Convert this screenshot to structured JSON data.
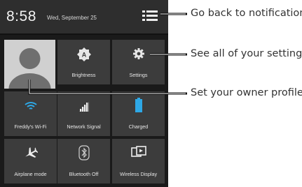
{
  "status_bar": {
    "time": "8:58",
    "date": "Wed, September 25",
    "notifications_icon": "notifications-list-icon"
  },
  "tiles": {
    "brightness": {
      "label": "Brightness",
      "icon": "brightness-auto-icon"
    },
    "settings": {
      "label": "Settings",
      "icon": "gear-icon"
    },
    "wifi": {
      "label": "Freddy's Wi-Fi",
      "icon": "wifi-icon"
    },
    "network": {
      "label": "Network Signal",
      "icon": "signal-bars-icon"
    },
    "battery": {
      "label": "Charged",
      "icon": "battery-icon"
    },
    "airplane": {
      "label": "Airplane mode",
      "icon": "airplane-icon"
    },
    "bluetooth": {
      "label": "Bluetooth Off",
      "icon": "bluetooth-icon"
    },
    "display": {
      "label": "Wireless Display",
      "icon": "wireless-display-icon"
    }
  },
  "owner_profile": {
    "icon": "profile-avatar-icon"
  },
  "callouts": {
    "notifications": "Go back to notifications.",
    "settings": "See all of your settings.",
    "owner": "Set your owner profile."
  },
  "colors": {
    "wifi_accent": "#2ea8e6",
    "battery_accent": "#2ea8e6",
    "panel_bg": "#1a1a1a",
    "tile_bg": "#3c3c3c"
  }
}
